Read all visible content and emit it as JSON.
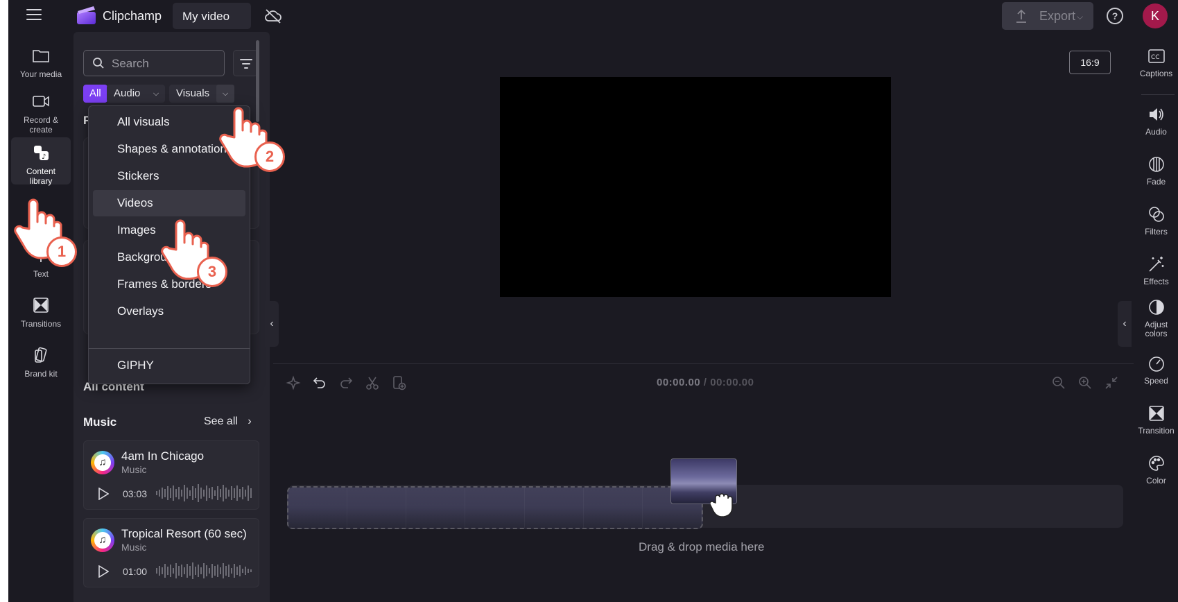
{
  "header": {
    "brand": "Clipchamp",
    "project_title": "My video",
    "export_label": "Export",
    "avatar_initial": "K"
  },
  "left_nav": {
    "items": [
      {
        "label": "Your media",
        "icon": "folder-icon"
      },
      {
        "label": "Record &\ncreate",
        "icon": "camera-icon"
      },
      {
        "label": "Content\nlibrary",
        "icon": "content-library-icon"
      },
      {
        "label": "Text",
        "icon": "text-icon"
      },
      {
        "label": "Transitions",
        "icon": "transitions-icon"
      },
      {
        "label": "Brand kit",
        "icon": "brand-kit-icon"
      }
    ]
  },
  "library": {
    "search_placeholder": "Search",
    "chips": {
      "all": "All",
      "audio": "Audio",
      "visuals": "Visuals"
    },
    "featured_heading": "Fe",
    "all_content_heading": "All content",
    "music_heading": "Music",
    "see_all": "See all",
    "music": [
      {
        "title": "4am In Chicago",
        "subtitle": "Music",
        "duration": "03:03"
      },
      {
        "title": "Tropical Resort (60 sec)",
        "subtitle": "Music",
        "duration": "01:00"
      }
    ]
  },
  "visuals_menu": {
    "items": [
      "All visuals",
      "Shapes & annotations",
      "Stickers",
      "Videos",
      "Images",
      "Backgrounds",
      "Frames & borders",
      "Overlays"
    ],
    "giphy": "GIPHY",
    "hovered": "Videos"
  },
  "preview": {
    "aspect_ratio": "16:9"
  },
  "timeline": {
    "current_time": "00:00.00",
    "separator": " / ",
    "total_time": "00:00.00",
    "drop_label": "Drag & drop media here"
  },
  "right_nav": {
    "items": [
      {
        "label": "Captions",
        "icon": "captions-icon"
      },
      {
        "label": "Audio",
        "icon": "speaker-icon"
      },
      {
        "label": "Fade",
        "icon": "fade-icon"
      },
      {
        "label": "Filters",
        "icon": "filters-icon"
      },
      {
        "label": "Effects",
        "icon": "magic-wand-icon"
      },
      {
        "label": "Adjust\ncolors",
        "icon": "adjust-colors-icon"
      },
      {
        "label": "Speed",
        "icon": "speedometer-icon"
      },
      {
        "label": "Transition",
        "icon": "transition-icon"
      },
      {
        "label": "Color",
        "icon": "palette-icon"
      }
    ]
  },
  "annotations": {
    "step_1": "1",
    "step_2": "2",
    "step_3": "3"
  },
  "colors": {
    "accent": "#7b3ff2",
    "avatar": "#a3194b",
    "badge": "#e9614f",
    "background": "#1b1a22",
    "panel": "#26252e"
  }
}
